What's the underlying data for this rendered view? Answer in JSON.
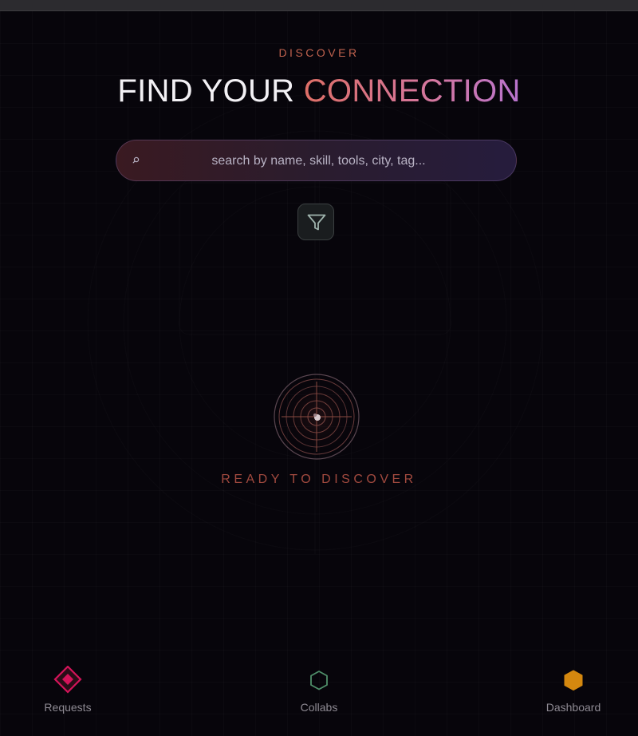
{
  "header": {
    "eyebrow": "DISCOVER",
    "title_plain": "FIND YOUR ",
    "title_accent": "CONNECTION"
  },
  "search": {
    "placeholder": "search by name, skill, tools, city, tag...",
    "value": ""
  },
  "filter": {
    "icon": "filter-icon"
  },
  "empty_state": {
    "icon": "radar-icon",
    "label": "READY TO DISCOVER"
  },
  "bottom_nav": {
    "items": [
      {
        "label": "Requests",
        "icon": "diamond-icon",
        "color": "#d4145a"
      },
      {
        "label": "Collabs",
        "icon": "hexagon-outline-icon",
        "color": "#4f8f6a"
      },
      {
        "label": "Dashboard",
        "icon": "hexagon-filled-icon",
        "color": "#d4880f"
      }
    ]
  },
  "colors": {
    "background": "#07050b",
    "eyebrow": "#c0624e",
    "accent_gradient_start": "#de6f67",
    "accent_gradient_end": "#b874cf",
    "ready_text": "#a24a3f"
  }
}
